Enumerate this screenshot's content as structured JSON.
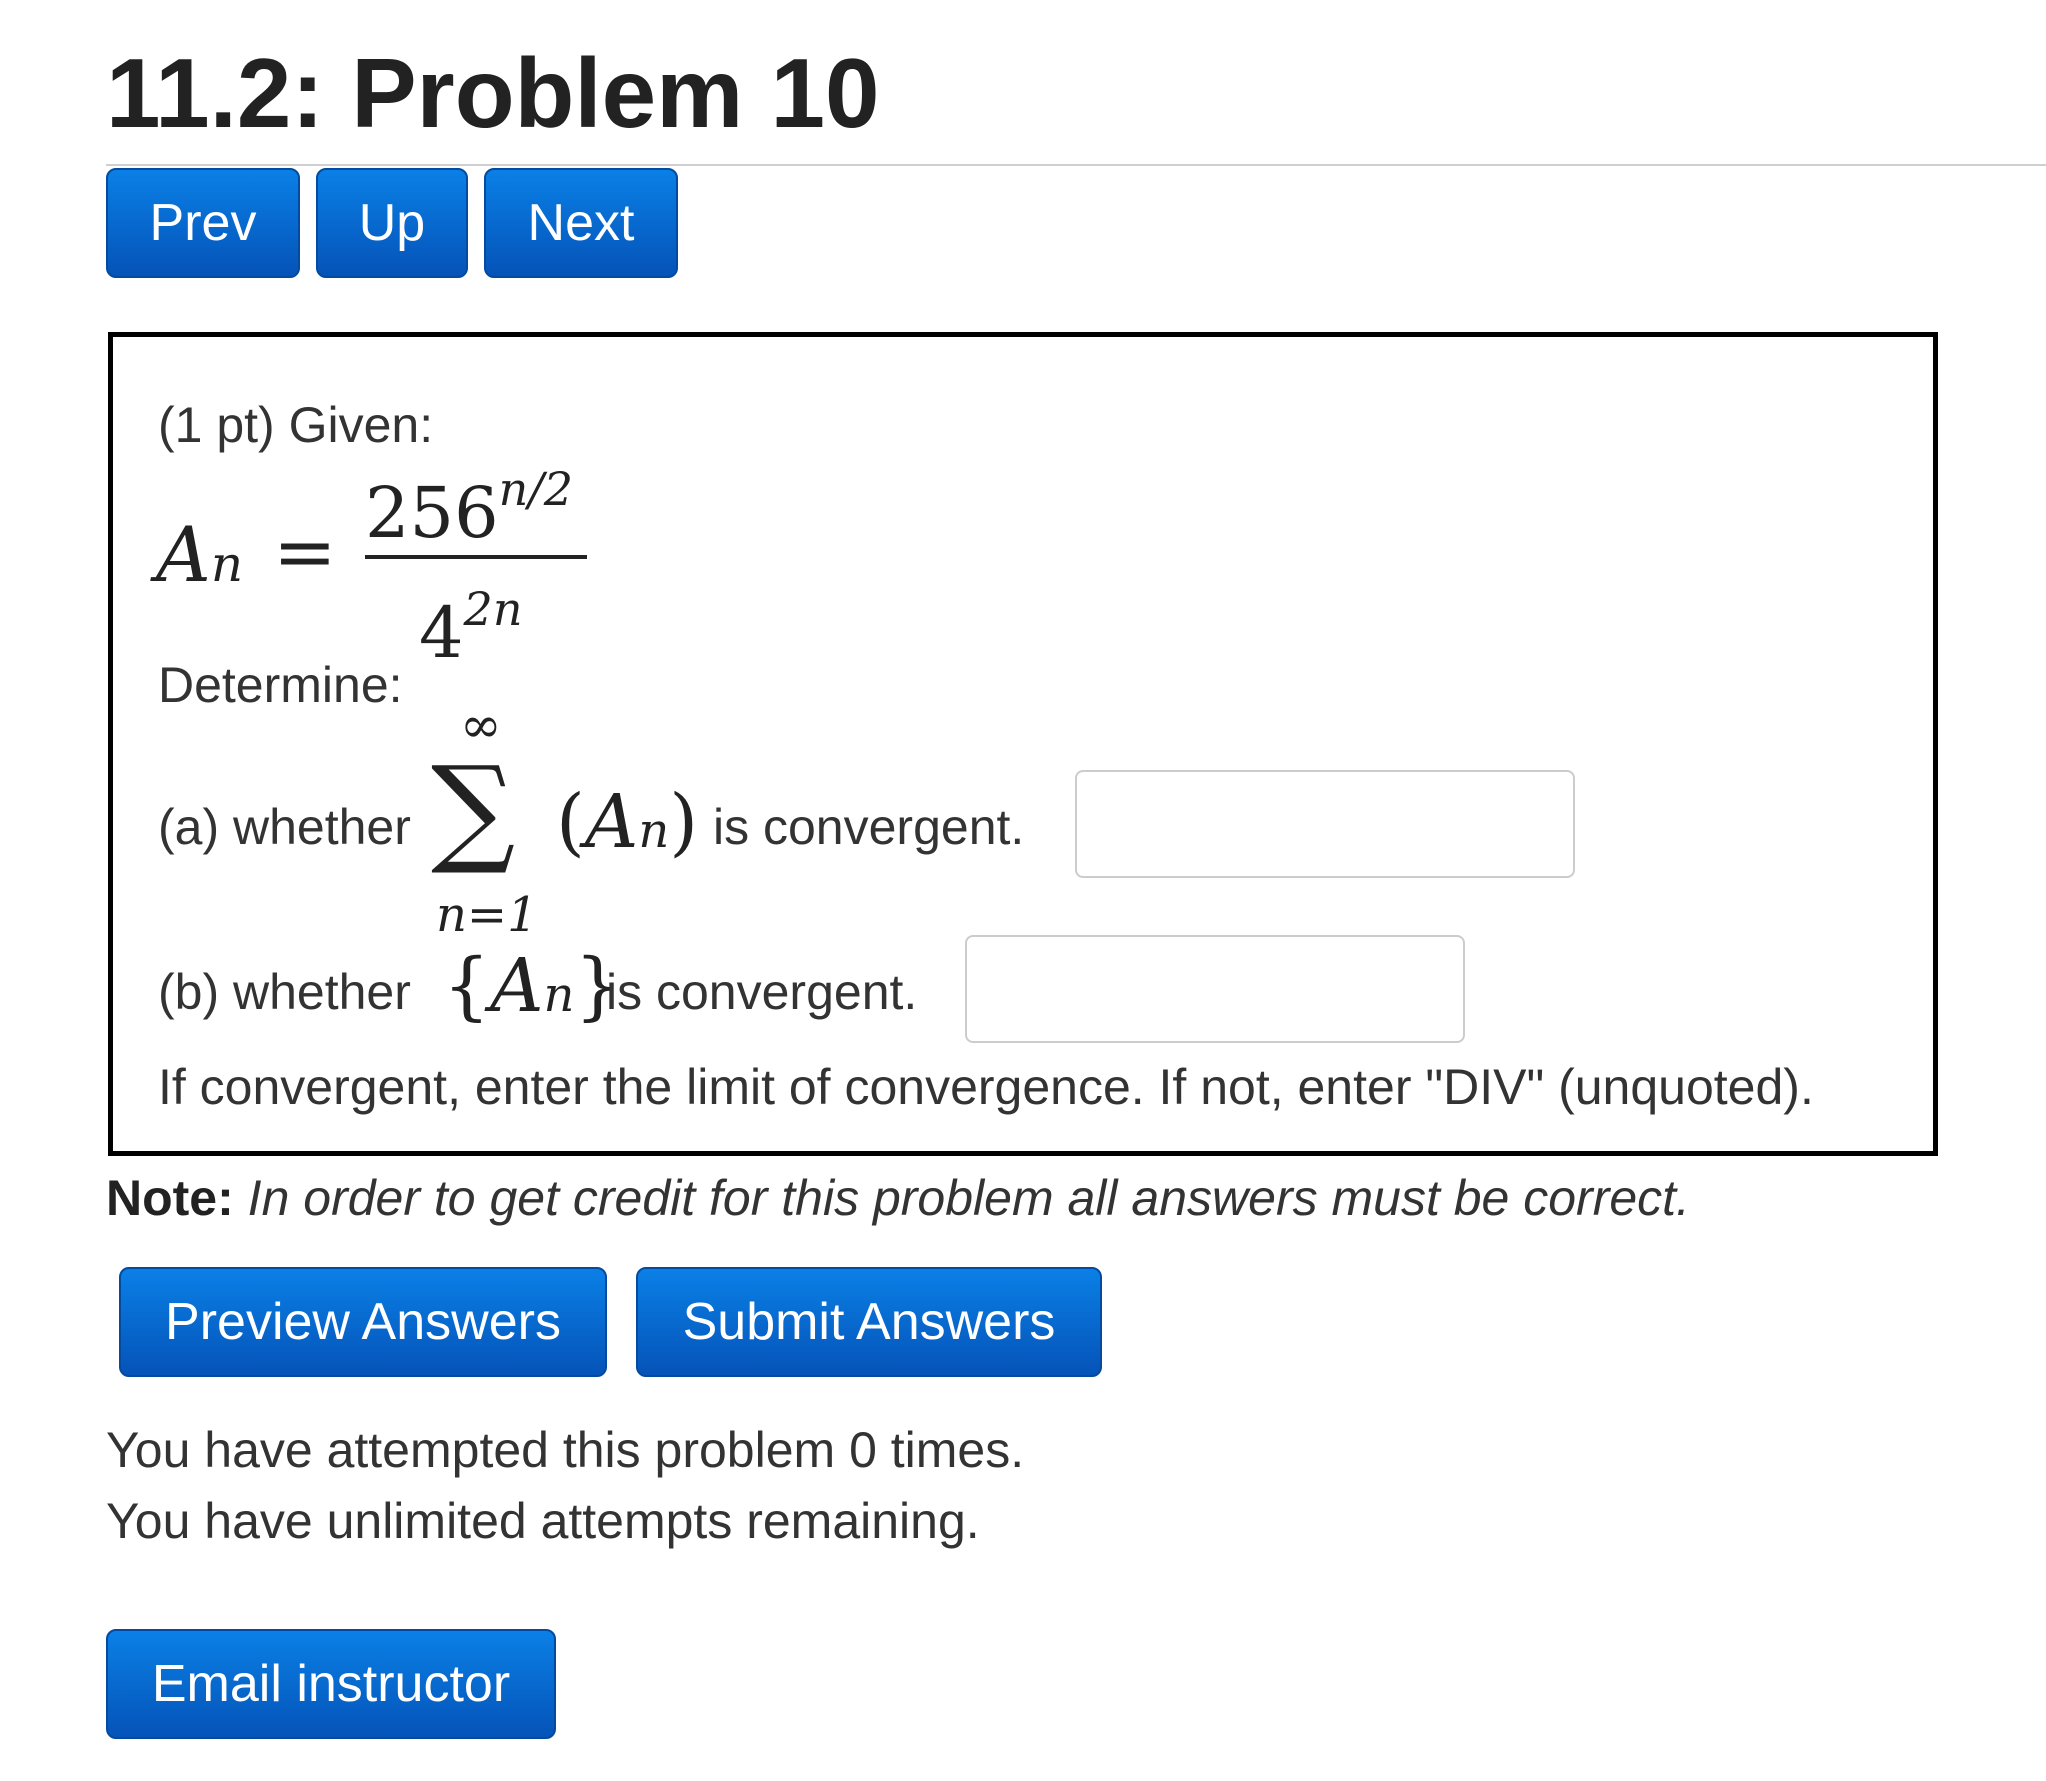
{
  "header": {
    "title": "11.2: Problem 10"
  },
  "nav": {
    "prev_label": "Prev",
    "up_label": "Up",
    "next_label": "Next"
  },
  "problem": {
    "points_intro": "(1 pt) Given:",
    "formula": {
      "lhs_base": "A",
      "lhs_sub": "n",
      "equals": "=",
      "numerator_base": "256",
      "numerator_exp": "n/2",
      "denominator_base": "4",
      "denominator_exp": "2n"
    },
    "determine_label": "Determine:",
    "part_a": {
      "prefix": "(a) whether",
      "sum_upper": "∞",
      "sum_symbol": "∑",
      "sum_lower": "n=1",
      "open_paren": "(",
      "term_base": "A",
      "term_sub": "n",
      "close_paren": ")",
      "suffix": "is convergent.",
      "answer_value": ""
    },
    "part_b": {
      "prefix": "(b) whether",
      "open_brace": "{",
      "term_base": "A",
      "term_sub": "n",
      "close_brace": "}",
      "suffix": "is convergent.",
      "answer_value": ""
    },
    "instructions": "If convergent, enter the limit of convergence. If not, enter \"DIV\" (unquoted)."
  },
  "note": {
    "label": "Note:",
    "text": "In order to get credit for this problem all answers must be correct."
  },
  "actions": {
    "preview_label": "Preview Answers",
    "submit_label": "Submit Answers"
  },
  "status": {
    "attempts_line": "You have attempted this problem 0 times.",
    "remaining_line": "You have unlimited attempts remaining."
  },
  "footer": {
    "email_label": "Email instructor"
  },
  "colors": {
    "button_top": "#0a80e6",
    "button_bottom": "#0553b8",
    "box_border": "#000000"
  }
}
